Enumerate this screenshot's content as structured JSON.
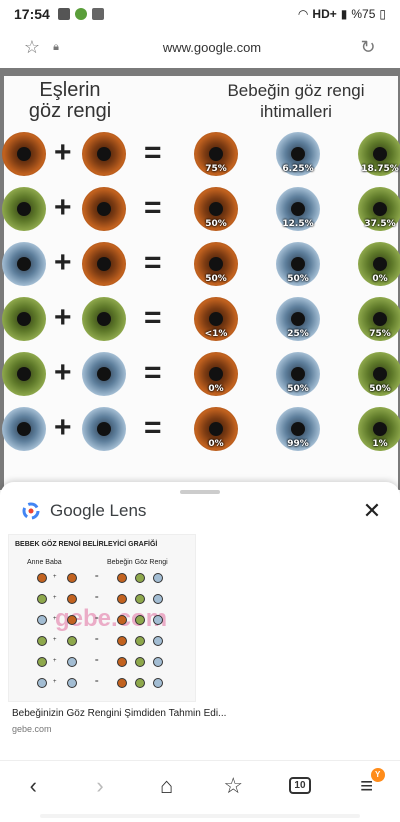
{
  "status": {
    "time": "17:54",
    "network": "HD+",
    "battery": "%75"
  },
  "browser": {
    "url": "www.google.com"
  },
  "chart": {
    "header_left": "Eşlerin göz rengi",
    "header_right": "Bebeğin göz rengi ihtimalleri",
    "rows": [
      {
        "p1": "brown",
        "p2": "brown",
        "r": [
          "75%",
          "6.25%",
          "18.75%"
        ]
      },
      {
        "p1": "green",
        "p2": "brown",
        "r": [
          "50%",
          "12.5%",
          "37.5%"
        ]
      },
      {
        "p1": "blue",
        "p2": "brown",
        "r": [
          "50%",
          "50%",
          "0%"
        ]
      },
      {
        "p1": "green",
        "p2": "green",
        "r": [
          "<1%",
          "25%",
          "75%"
        ]
      },
      {
        "p1": "green",
        "p2": "blue",
        "r": [
          "0%",
          "50%",
          "50%"
        ]
      },
      {
        "p1": "blue",
        "p2": "blue",
        "r": [
          "0%",
          "99%",
          "1%"
        ]
      }
    ],
    "colors": {
      "brown": "#c2621f",
      "green": "#8ea84c",
      "blue": "#a3bdd3"
    }
  },
  "lens": {
    "title": "Google Lens",
    "close_icon": "close-icon",
    "thumb": {
      "title": "BEBEK GÖZ RENGİ BELİRLEYİCİ GRAFİĞİ",
      "col_left": "Anne Baba",
      "col_right": "Bebeğin Göz Rengi",
      "watermark": "gebe.com"
    },
    "result_title": "Bebeğinizin Göz Rengini Şimdiden Tahmin Edi...",
    "result_domain": "gebe.com"
  },
  "nav": {
    "tabs": "10",
    "badge": "Y"
  }
}
